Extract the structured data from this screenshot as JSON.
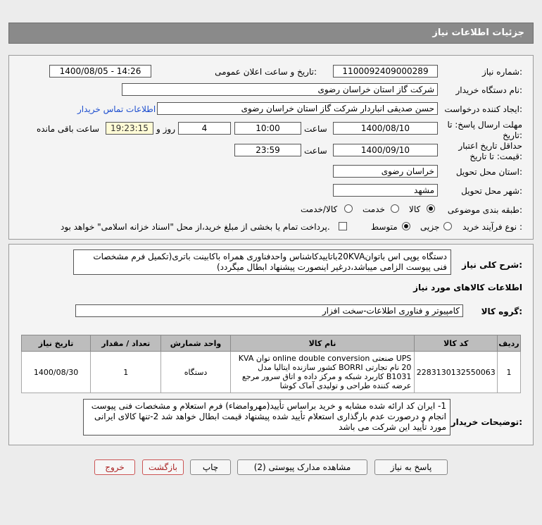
{
  "header": {
    "title": "جزئیات اطلاعات نیاز"
  },
  "form": {
    "need_number_label": "شماره نیاز:",
    "need_number": "1100092409000289",
    "announce_label": "تاریخ و ساعت اعلان عمومی:",
    "announce_value": "1400/08/05 - 14:26",
    "buyer_org_label": "نام دستگاه خریدار:",
    "buyer_org": "شرکت گاز استان خراسان رضوی",
    "creator_label": "ایجاد کننده درخواست:",
    "creator": "حسن صدیقی انباردار شرکت گاز استان خراسان رضوی",
    "contact_link": "اطلاعات تماس خریدار",
    "deadline_label_1": "مهلت ارسال پاسخ: تا",
    "deadline_label_2": "تاریخ:",
    "deadline_date": "1400/08/10",
    "hour_label": "ساعت",
    "deadline_time": "10:00",
    "days": "4",
    "days_label": "روز و",
    "remaining_time": "19:23:15",
    "remaining_label": "ساعت باقی مانده",
    "validity_label_1": "حداقل تاریخ اعتبار",
    "validity_label_2": "قیمت: تا تاریخ:",
    "validity_date": "1400/09/10",
    "validity_time": "23:59",
    "province_label": "استان محل تحویل:",
    "province": "خراسان رضوی",
    "city_label": "شهر محل تحویل:",
    "city": "مشهد",
    "category_label": "طبقه بندی موضوعی:",
    "cat_goods": "کالا",
    "cat_service": "خدمت",
    "cat_goods_service": "کالا/خدمت",
    "process_label": "نوع فرآیند خرید :",
    "proc_minor": "جزیی",
    "proc_medium": "متوسط",
    "payment_note": "پرداخت تمام یا بخشی از مبلغ خرید،از محل \"اسناد خزانه اسلامی\" خواهد بود."
  },
  "summary": {
    "label": "شرح کلی نیاز:",
    "text": "دستگاه یوپی اس باتوان20KVAباتاییدکاشناس واحدفناوری همراه باکابینت باتری(تکمیل فرم مشخصات فنی پیوست الزامی میباشد،درغیر اینصورت پیشنهاد ابطال میگردد)",
    "items_heading": "اطلاعات کالاهای مورد نیاز",
    "group_label": "گروه کالا:",
    "group_value": "کامپیوتر و فناوری اطلاعات-سخت افزار"
  },
  "table": {
    "headers": {
      "row": "ردیف",
      "code": "کد کالا",
      "name": "نام کالا",
      "unit": "واحد شمارش",
      "qty": "تعداد / مقدار",
      "date": "تاریخ نیاز"
    },
    "rows": [
      {
        "row": "1",
        "code": "2283130132550063",
        "name": "UPS صنعتی online double conversion توان KVA 20 نام تجارتی BORRI کشور سازنده ایتالیا مدل B1031 کاربرد شبکه و مرکز داده و اتاق سرور مرجع عرضه کننده طراحی و تولیدی آماک کوشا",
        "unit": "دستگاه",
        "qty": "1",
        "date": "1400/08/30"
      }
    ]
  },
  "buyer_notes": {
    "label": "توضیحات خریدار:",
    "text": "1- ایران کد ارائه شده مشابه و خرید براساس تأیید(مهروامضاء) فرم استعلام و مشخصات فنی پیوست انجام و درصورت عدم بارگذاری استعلام تأیید شده پیشنهاد قیمت ابطال خواهد شد 2-تنها کالای ایرانی مورد تأیید این شرکت می باشد"
  },
  "buttons": {
    "reply": "پاسخ به نیاز",
    "view_docs": "مشاهده مدارک پیوستی (2)",
    "print": "چاپ",
    "back": "بازگشت",
    "exit": "خروج"
  }
}
